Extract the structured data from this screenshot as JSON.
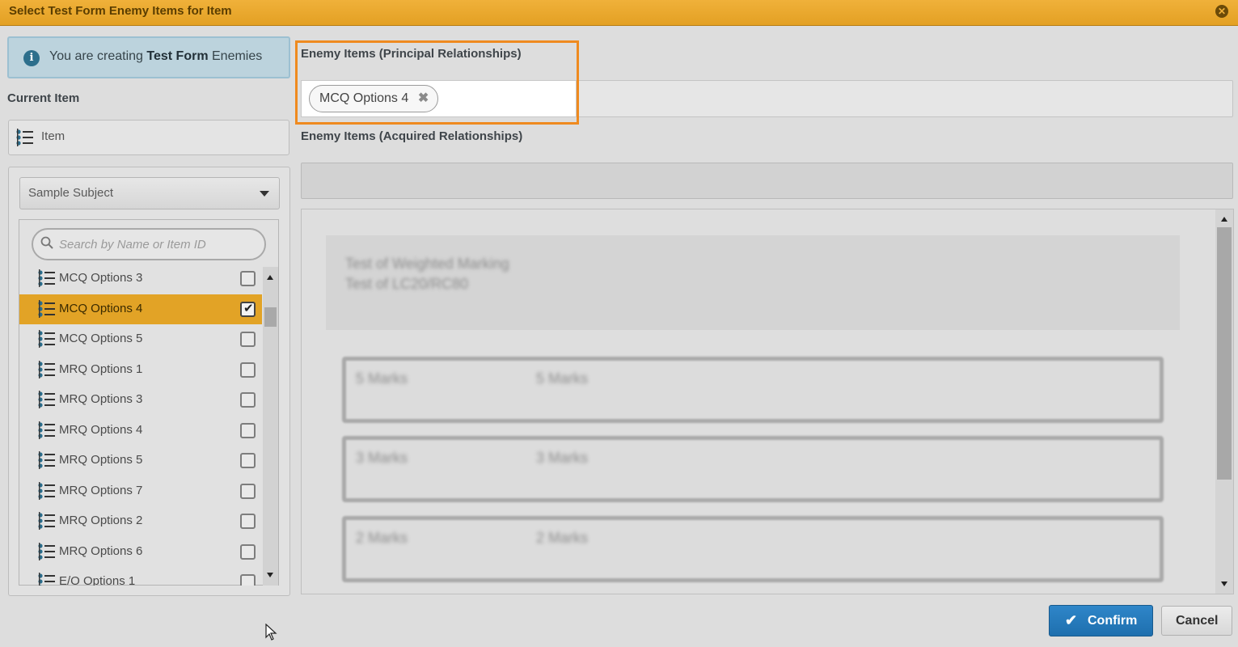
{
  "dialog": {
    "title": "Select Test Form Enemy Items for Item",
    "close_icon": "close-icon"
  },
  "info": {
    "icon": "info-icon",
    "prefix": "You are creating ",
    "bold": "Test Form",
    "suffix": " Enemies"
  },
  "current_item": {
    "heading": "Current Item",
    "label": "Item",
    "icon": "list-item-icon"
  },
  "subject_select": {
    "value": "Sample Subject"
  },
  "search": {
    "placeholder": "Search by Name or Item ID"
  },
  "items": [
    {
      "name": "MCQ Options 3",
      "checked": false,
      "selected": false
    },
    {
      "name": "MCQ Options 4",
      "checked": true,
      "selected": true
    },
    {
      "name": "MCQ Options 5",
      "checked": false,
      "selected": false
    },
    {
      "name": "MRQ Options 1",
      "checked": false,
      "selected": false
    },
    {
      "name": "MRQ Options 3",
      "checked": false,
      "selected": false
    },
    {
      "name": "MRQ Options 4",
      "checked": false,
      "selected": false
    },
    {
      "name": "MRQ Options 5",
      "checked": false,
      "selected": false
    },
    {
      "name": "MRQ Options 7",
      "checked": false,
      "selected": false
    },
    {
      "name": "MRQ Options 2",
      "checked": false,
      "selected": false
    },
    {
      "name": "MRQ Options 6",
      "checked": false,
      "selected": false
    },
    {
      "name": "E/O Options 1",
      "checked": false,
      "selected": false
    }
  ],
  "principal": {
    "heading": "Enemy Items (Principal Relationships)",
    "tags": [
      "MCQ Options 4"
    ]
  },
  "acquired": {
    "heading": "Enemy Items (Acquired Relationships)"
  },
  "preview": {
    "header_line1": "Test of Weighted Marking",
    "header_line2": "Test of LC20/RC80",
    "boxes": [
      {
        "left": "5 Marks",
        "right": "5 Marks"
      },
      {
        "left": "3 Marks",
        "right": "3 Marks"
      },
      {
        "left": "2 Marks",
        "right": "2 Marks"
      }
    ]
  },
  "buttons": {
    "confirm": "Confirm",
    "cancel": "Cancel"
  },
  "colors": {
    "titlebar": "#e3a023",
    "selected_row": "#e2a326",
    "highlight": "#ef8a1f",
    "confirm": "#1e6fae"
  }
}
